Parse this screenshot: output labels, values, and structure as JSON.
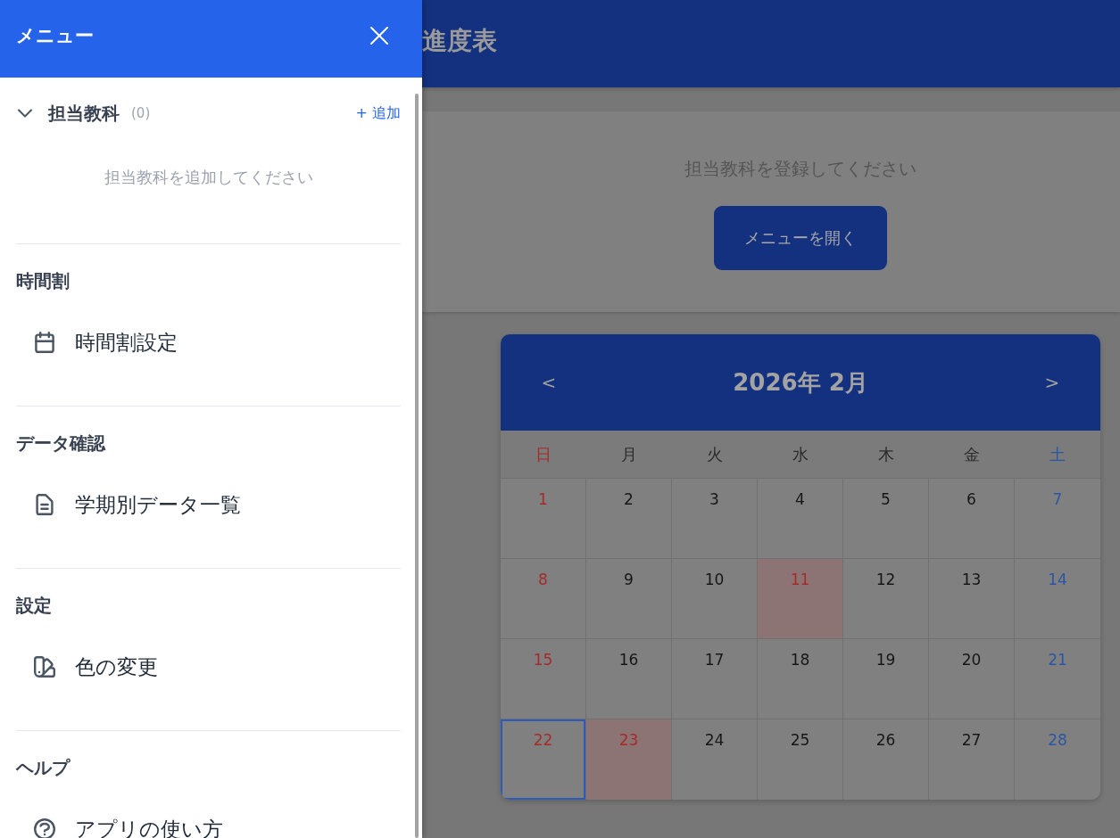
{
  "drawer": {
    "title": "メニュー",
    "subjects": {
      "label": "担当教科",
      "count": "(0)",
      "expanded": true,
      "add_label": "+ 追加",
      "empty_message": "担当教科を追加してください"
    },
    "sections": [
      {
        "heading": "時間割",
        "items": [
          {
            "label": "時間割設定"
          }
        ]
      },
      {
        "heading": "データ確認",
        "items": [
          {
            "label": "学期別データ一覧"
          }
        ]
      },
      {
        "heading": "設定",
        "items": [
          {
            "label": "色の変更"
          }
        ]
      },
      {
        "heading": "ヘルプ",
        "items": [
          {
            "label": "アプリの使い方"
          }
        ]
      }
    ]
  },
  "header": {
    "title": "進度表"
  },
  "notice": {
    "message": "担当教科を登録してください",
    "button": "メニューを開く"
  },
  "calendar": {
    "title": "2026年 2月",
    "prev": "<",
    "next": ">",
    "weekdays": [
      "日",
      "月",
      "火",
      "水",
      "木",
      "金",
      "土"
    ],
    "weeks": [
      [
        {
          "day": "1",
          "holiday": false,
          "selected": false
        },
        {
          "day": "2",
          "holiday": false,
          "selected": false
        },
        {
          "day": "3",
          "holiday": false,
          "selected": false
        },
        {
          "day": "4",
          "holiday": false,
          "selected": false
        },
        {
          "day": "5",
          "holiday": false,
          "selected": false
        },
        {
          "day": "6",
          "holiday": false,
          "selected": false
        },
        {
          "day": "7",
          "holiday": false,
          "selected": false
        }
      ],
      [
        {
          "day": "8",
          "holiday": false,
          "selected": false
        },
        {
          "day": "9",
          "holiday": false,
          "selected": false
        },
        {
          "day": "10",
          "holiday": false,
          "selected": false
        },
        {
          "day": "11",
          "holiday": true,
          "selected": false
        },
        {
          "day": "12",
          "holiday": false,
          "selected": false
        },
        {
          "day": "13",
          "holiday": false,
          "selected": false
        },
        {
          "day": "14",
          "holiday": false,
          "selected": false
        }
      ],
      [
        {
          "day": "15",
          "holiday": false,
          "selected": false
        },
        {
          "day": "16",
          "holiday": false,
          "selected": false
        },
        {
          "day": "17",
          "holiday": false,
          "selected": false
        },
        {
          "day": "18",
          "holiday": false,
          "selected": false
        },
        {
          "day": "19",
          "holiday": false,
          "selected": false
        },
        {
          "day": "20",
          "holiday": false,
          "selected": false
        },
        {
          "day": "21",
          "holiday": false,
          "selected": false
        }
      ],
      [
        {
          "day": "22",
          "holiday": false,
          "selected": true
        },
        {
          "day": "23",
          "holiday": true,
          "selected": false
        },
        {
          "day": "24",
          "holiday": false,
          "selected": false
        },
        {
          "day": "25",
          "holiday": false,
          "selected": false
        },
        {
          "day": "26",
          "holiday": false,
          "selected": false
        },
        {
          "day": "27",
          "holiday": false,
          "selected": false
        },
        {
          "day": "28",
          "holiday": false,
          "selected": false
        }
      ]
    ]
  }
}
